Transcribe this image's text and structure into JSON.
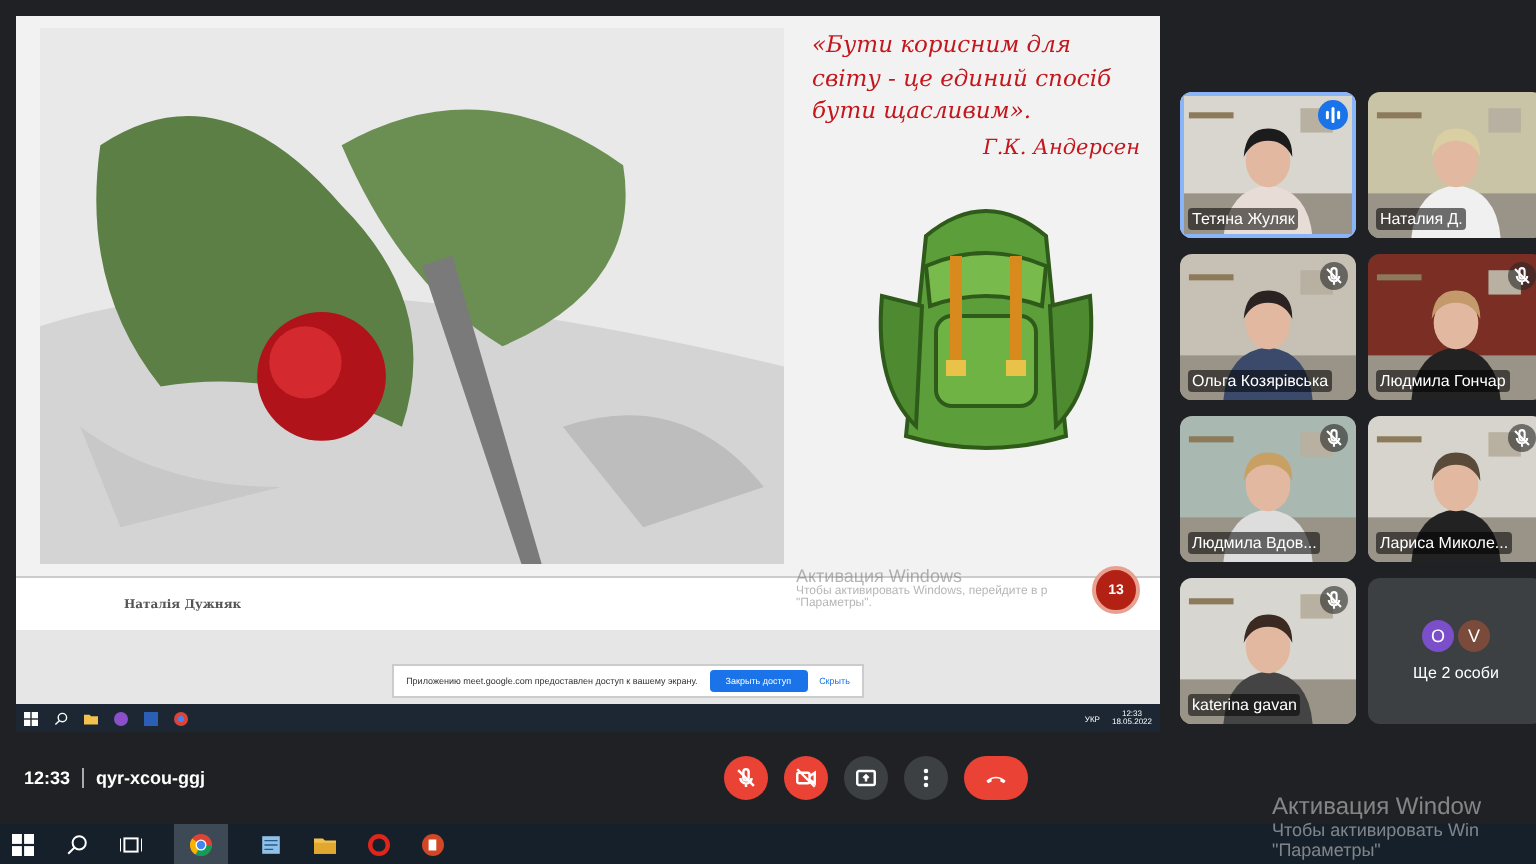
{
  "shared_screen": {
    "quote": "«Бути корисним для світу - це единий спосіб бути щасливим».",
    "quote_author": "Г.К. Андерсен",
    "footer_name": "Наталія Дужняк",
    "slide_number": "13",
    "inner_watermark": {
      "title": "Активация Windows",
      "line_1": "Чтобы активировать Windows, перейдите в р",
      "line_2": "\"Параметры\"."
    },
    "share_notice": {
      "message": "Приложению meet.google.com предоставлен доступ к вашему экрану.",
      "stop_button": "Закрыть доступ",
      "hide_link": "Скрыть"
    },
    "taskbar": {
      "language": "УКР",
      "time": "12:33",
      "date": "18.05.2022"
    }
  },
  "participants": [
    {
      "kind": "video",
      "name": "Тетяна Жуляк",
      "speaking": true,
      "muted": false
    },
    {
      "kind": "video",
      "name": "Наталия Д.",
      "speaking": false,
      "muted": false
    },
    {
      "kind": "video",
      "name": "Ольга Козярівська",
      "speaking": false,
      "muted": true
    },
    {
      "kind": "video",
      "name": "Людмила Гончар",
      "speaking": false,
      "muted": true
    },
    {
      "kind": "video",
      "name": "Людмила Вдов...",
      "speaking": false,
      "muted": true
    },
    {
      "kind": "video",
      "name": "Лариса Миколе...",
      "speaking": false,
      "muted": true
    },
    {
      "kind": "video",
      "name": "katerina gavan",
      "speaking": false,
      "muted": true
    },
    {
      "kind": "others",
      "label": "Ще 2 особи",
      "avatars": [
        {
          "letter": "O",
          "color": "#7b4fc9"
        },
        {
          "letter": "V",
          "color": "#7a4a3a"
        }
      ]
    }
  ],
  "meeting_bar": {
    "time": "12:33",
    "code": "qyr-xcou-ggj",
    "controls": [
      {
        "kind": "mic",
        "off": true
      },
      {
        "kind": "camera",
        "off": true
      },
      {
        "kind": "present",
        "off": false
      },
      {
        "kind": "more",
        "off": false
      },
      {
        "kind": "hangup"
      }
    ]
  },
  "watermark": {
    "title": "Активация Window",
    "line_1": "Чтобы активировать Win",
    "line_2": "\"Параметры\""
  }
}
